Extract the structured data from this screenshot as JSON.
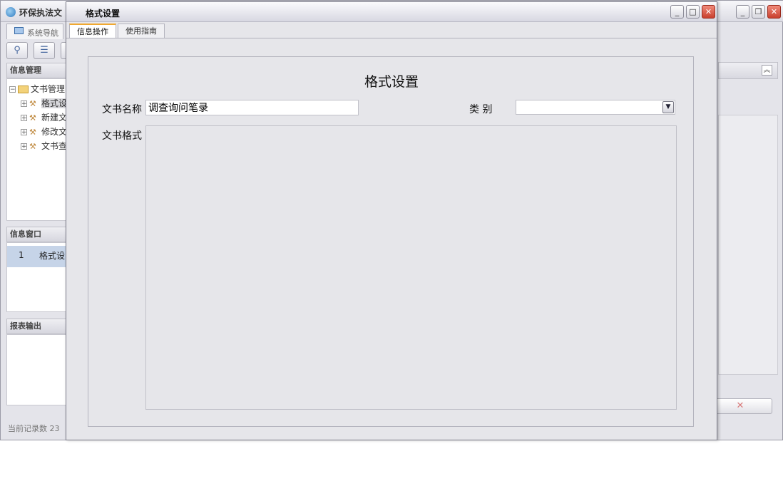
{
  "main_window": {
    "title": "环保执法文",
    "nav_tab_label": "系统导航",
    "toolbar": {
      "icons": [
        "search-icon",
        "list-icon",
        "more-icon"
      ]
    },
    "info_panel": {
      "header": "信息管理",
      "tree": {
        "root": "文书管理",
        "children": [
          "格式设",
          "新建文",
          "修改文",
          "文书查"
        ]
      }
    },
    "window_panel": {
      "header": "信息窗口",
      "rows": [
        {
          "index": "1",
          "label": "格式设"
        }
      ]
    },
    "report_panel": {
      "header": "报表输出"
    },
    "status": "当前记录数 23",
    "cancel_glyph": "✕"
  },
  "dialog": {
    "title": "格式设置",
    "tabs": [
      {
        "label": "信息操作",
        "active": true
      },
      {
        "label": "使用指南",
        "active": false
      }
    ],
    "form": {
      "heading": "格式设置",
      "name_label": "文书名称",
      "name_value": "调查询问笔录",
      "category_label": "类 别",
      "category_value": "",
      "format_label": "文书格式",
      "format_value": ""
    }
  },
  "colors": {
    "active_tab_accent": "#f0a830",
    "close_button": "#c9402e",
    "list_selection": "#c6d4e8"
  }
}
